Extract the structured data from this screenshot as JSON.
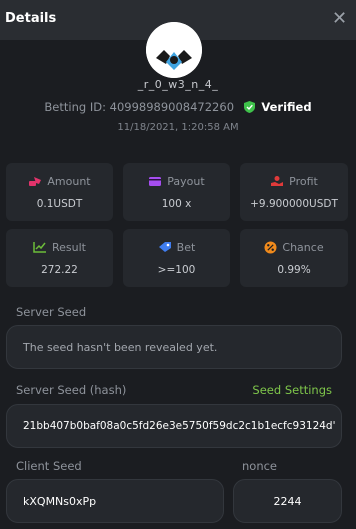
{
  "header": {
    "title": "Details",
    "close_label": "✕"
  },
  "user": {
    "username": "_r_0_w3_n_4_",
    "betting_id_label": "Betting ID:",
    "betting_id": "40998989008472260",
    "verified_label": "Verified",
    "datetime": "11/18/2021, 1:20:58 AM"
  },
  "stats": [
    {
      "label": "Amount",
      "value": "0.1USDT",
      "icon": "amount-icon",
      "color": "#e2336b"
    },
    {
      "label": "Payout",
      "value": "100 x",
      "icon": "payout-wallet-icon",
      "color": "#a64ef0"
    },
    {
      "label": "Profit",
      "value": "+9.900000USDT",
      "icon": "profit-icon",
      "color": "#e03a3a"
    },
    {
      "label": "Result",
      "value": "272.22",
      "icon": "result-chart-icon",
      "color": "#6dbd3a"
    },
    {
      "label": "Bet",
      "value": ">=100",
      "icon": "bet-icon",
      "color": "#3f7df0"
    },
    {
      "label": "Chance",
      "value": "0.99%",
      "icon": "chance-icon",
      "color": "#f08a1c"
    }
  ],
  "seeds": {
    "server_seed_label": "Server Seed",
    "server_seed_value": "The seed hasn't been revealed yet.",
    "server_hash_label": "Server Seed (hash)",
    "seed_settings_link": "Seed Settings",
    "server_hash_value": "21bb407b0baf08a0c5fd26e3e5750f59dc2c1b1ecfc93124d'",
    "client_seed_label": "Client Seed",
    "client_seed_value": "kXQMNs0xPp",
    "nonce_label": "nonce",
    "nonce_value": "2244"
  }
}
